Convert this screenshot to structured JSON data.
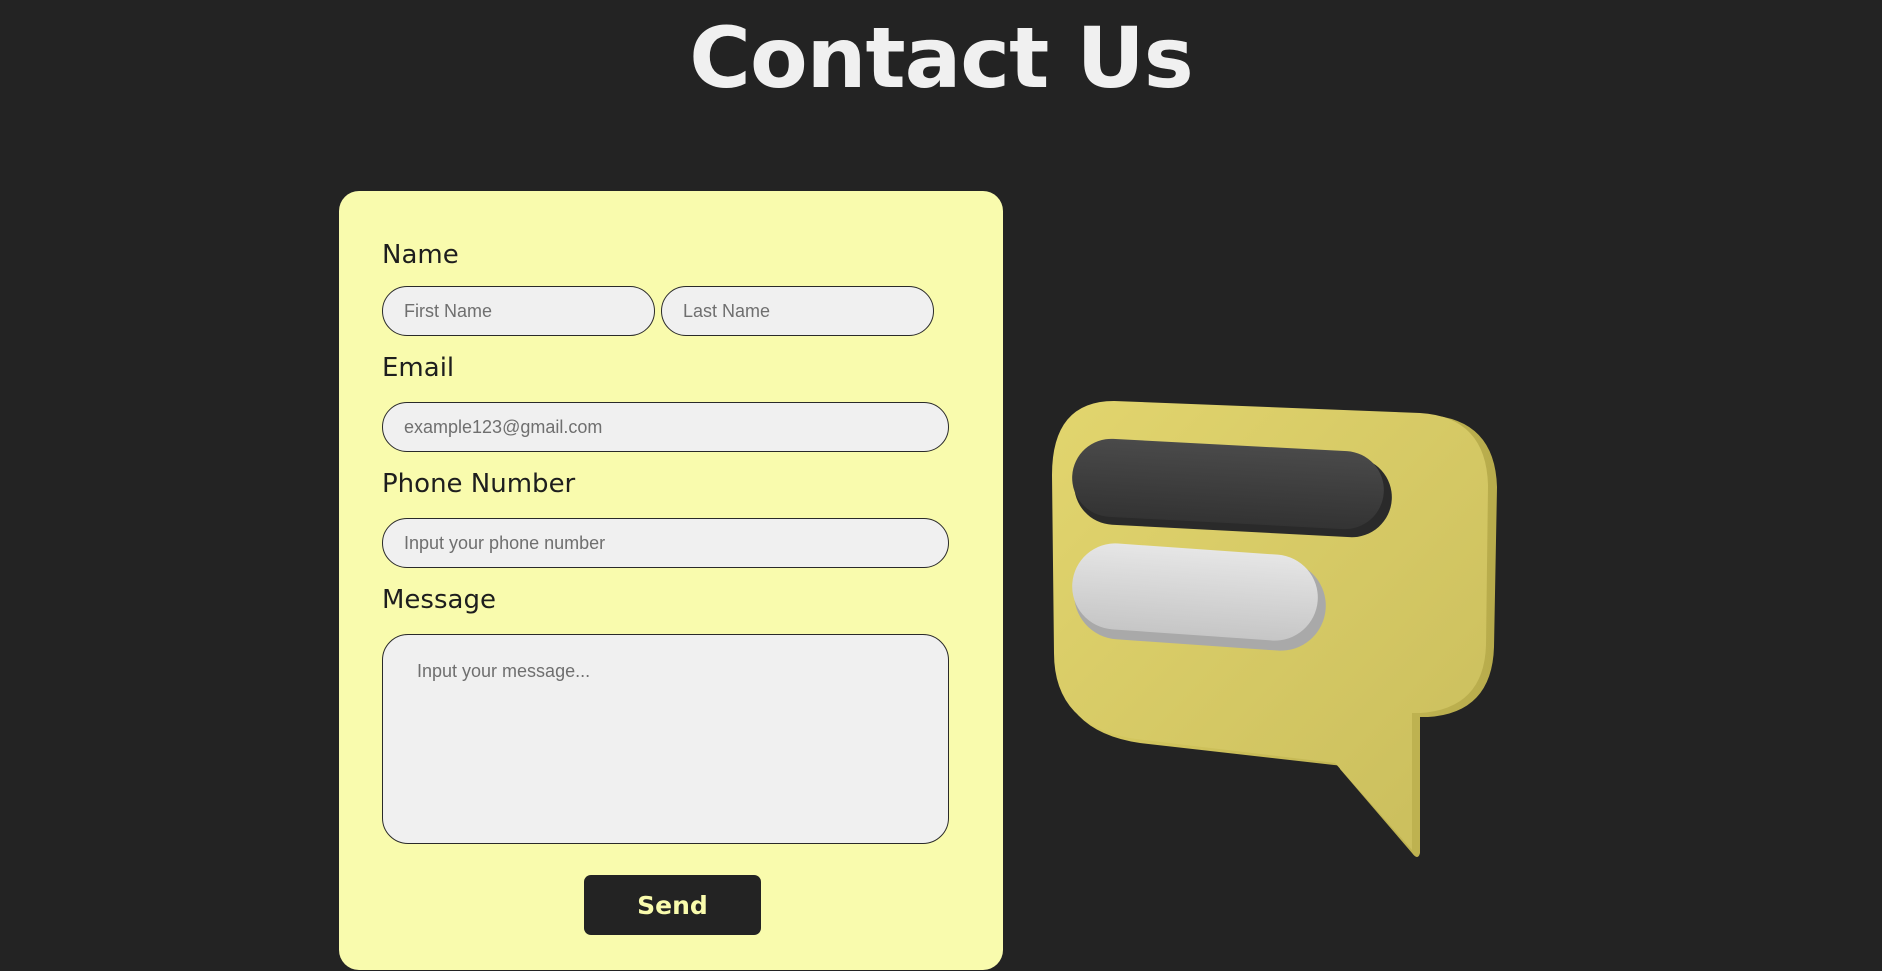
{
  "page": {
    "title": "Contact Us"
  },
  "form": {
    "name_label": "Name",
    "first_name_placeholder": "First Name",
    "last_name_placeholder": "Last Name",
    "email_label": "Email",
    "email_placeholder": "example123@gmail.com",
    "phone_label": "Phone Number",
    "phone_placeholder": "Input your phone number",
    "message_label": "Message",
    "message_placeholder": "Input your message...",
    "send_label": "Send"
  },
  "colors": {
    "background": "#232323",
    "card": "#f9fbad",
    "button": "#232323",
    "button_text": "#f9fbad",
    "title": "#f0f0f0"
  },
  "illustration": {
    "icon": "chat-bubble-icon"
  }
}
